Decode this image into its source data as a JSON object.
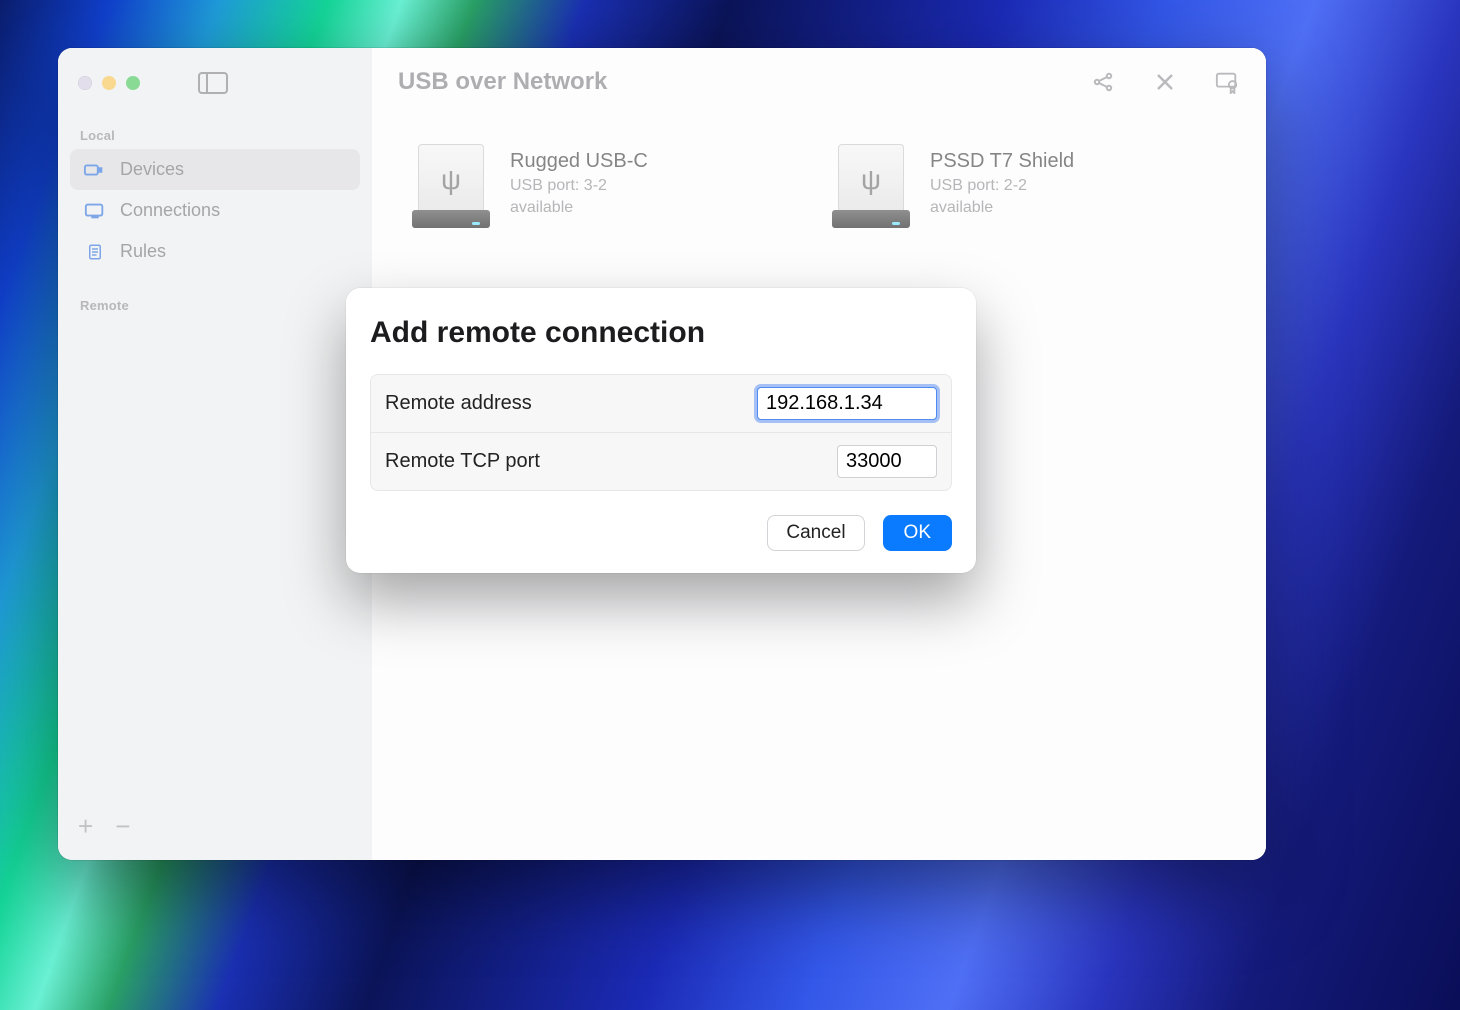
{
  "window": {
    "title": "USB over Network"
  },
  "sidebar": {
    "sections": {
      "local_label": "Local",
      "remote_label": "Remote"
    },
    "items": [
      {
        "label": "Devices"
      },
      {
        "label": "Connections"
      },
      {
        "label": "Rules"
      }
    ]
  },
  "devices": [
    {
      "name": "Rugged USB-C",
      "port": "USB port: 3-2",
      "status": "available"
    },
    {
      "name": "PSSD T7 Shield",
      "port": "USB port: 2-2",
      "status": "available"
    }
  ],
  "modal": {
    "title": "Add remote connection",
    "fields": {
      "address_label": "Remote address",
      "address_value": "192.168.1.34",
      "port_label": "Remote TCP port",
      "port_value": "33000"
    },
    "buttons": {
      "cancel": "Cancel",
      "ok": "OK"
    }
  }
}
